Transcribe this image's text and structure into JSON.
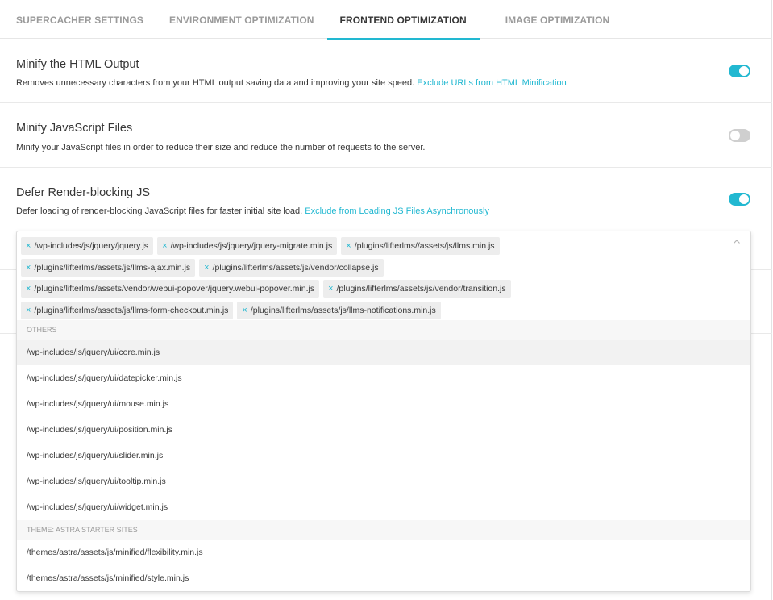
{
  "tabs": [
    {
      "label": "SUPERCACHER SETTINGS",
      "active": false
    },
    {
      "label": "ENVIRONMENT OPTIMIZATION",
      "active": false
    },
    {
      "label": "FRONTEND OPTIMIZATION",
      "active": true
    },
    {
      "label": "IMAGE OPTIMIZATION",
      "active": false
    }
  ],
  "settings": {
    "minify_html": {
      "title": "Minify the HTML Output",
      "description": "Removes unnecessary characters from your HTML output saving data and improving your site speed.",
      "link": "Exclude URLs from HTML Minification",
      "enabled": true
    },
    "minify_js": {
      "title": "Minify JavaScript Files",
      "description": "Minify your JavaScript files in order to reduce their size and reduce the number of requests to the server.",
      "enabled": false
    },
    "defer_js": {
      "title": "Defer Render-blocking JS",
      "description": "Defer loading of render-blocking JavaScript files for faster initial site load.",
      "link": "Exclude from Loading JS Files Asynchronously",
      "enabled": true
    }
  },
  "colors": {
    "accent": "#22b8d1",
    "toggle_off": "#cfcfcf"
  },
  "exclude_select": {
    "selected": [
      "/wp-includes/js/jquery/jquery.js",
      "/wp-includes/js/jquery/jquery-migrate.min.js",
      "/plugins/lifterlms//assets/js/llms.min.js",
      "/plugins/lifterlms/assets/js/llms-ajax.min.js",
      "/plugins/lifterlms/assets/js/vendor/collapse.js",
      "/plugins/lifterlms/assets/vendor/webui-popover/jquery.webui-popover.min.js",
      "/plugins/lifterlms/assets/js/vendor/transition.js",
      "/plugins/lifterlms/assets/js/llms-form-checkout.min.js",
      "/plugins/lifterlms/assets/js/llms-notifications.min.js"
    ],
    "remove_symbol": "×",
    "chevron_icon": "chevron-up-icon",
    "groups": [
      {
        "label": "OTHERS",
        "options": [
          "/wp-includes/js/jquery/ui/core.min.js",
          "/wp-includes/js/jquery/ui/datepicker.min.js",
          "/wp-includes/js/jquery/ui/mouse.min.js",
          "/wp-includes/js/jquery/ui/position.min.js",
          "/wp-includes/js/jquery/ui/slider.min.js",
          "/wp-includes/js/jquery/ui/tooltip.min.js",
          "/wp-includes/js/jquery/ui/widget.min.js"
        ]
      },
      {
        "label": "THEME: ASTRA STARTER SITES",
        "options": [
          "/themes/astra/assets/js/minified/flexibility.min.js",
          "/themes/astra/assets/js/minified/style.min.js"
        ]
      }
    ]
  }
}
